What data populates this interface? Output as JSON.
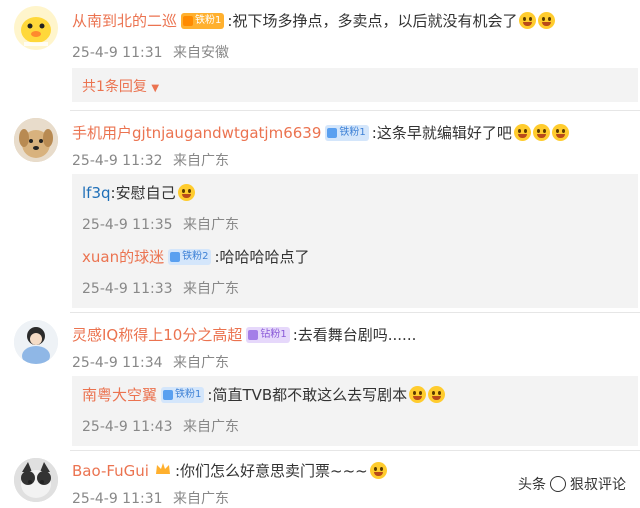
{
  "comments": [
    {
      "user": "从南到北的二巡",
      "badge": "铁粉1",
      "text": ":祝下场多挣点，多卖点，以后就没有机会了",
      "time": "25-4-9 11:31",
      "source": "来自安徽",
      "more_replies": "共1条回复",
      "replies": []
    },
    {
      "user": "手机用户gjtnjaugandwtgatjm6639",
      "badge": "铁粉1",
      "text": ":这条早就编辑好了吧",
      "time": "25-4-9 11:32",
      "source": "来自广东",
      "replies": [
        {
          "user": "lf3q",
          "text": ":安慰自己",
          "time": "25-4-9 11:35",
          "source": "来自广东"
        },
        {
          "user": "xuan的球迷",
          "badge": "铁粉2",
          "text": ":哈哈哈哈点了",
          "time": "25-4-9 11:33",
          "source": "来自广东"
        }
      ]
    },
    {
      "user": "灵感IQ称得上10分之高超",
      "badge": "钻粉1",
      "text": ":去看舞台剧吗......",
      "time": "25-4-9 11:34",
      "source": "来自广东",
      "replies": [
        {
          "user": "南粤大空翼",
          "badge": "铁粉1",
          "text": ":简直TVB都不敢这么去写剧本",
          "time": "25-4-9 11:43",
          "source": "来自广东"
        }
      ]
    },
    {
      "user": "Bao-FuGui",
      "text": ":你们怎么好意思卖门票~~~",
      "time": "25-4-9 11:31",
      "source": "来自广东",
      "replies": []
    }
  ],
  "watermark": {
    "prefix": "头条",
    "handle": "狠叔评论"
  }
}
